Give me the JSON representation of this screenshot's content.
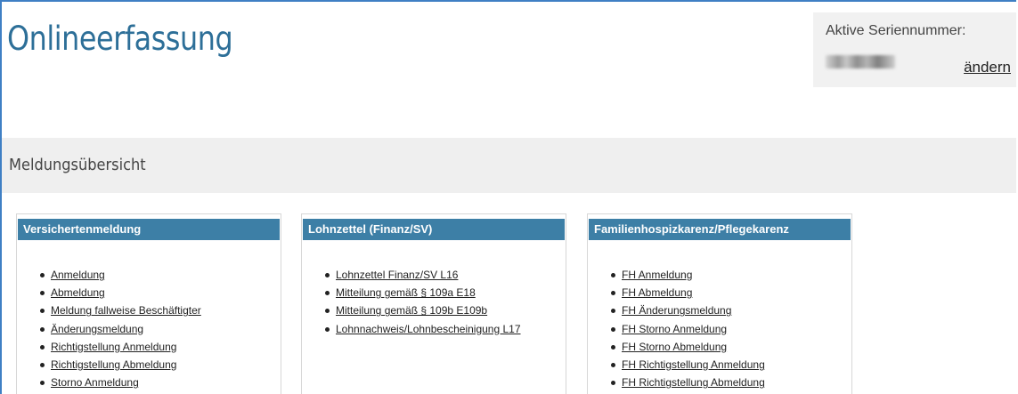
{
  "header": {
    "title": "Onlineerfassung"
  },
  "serial": {
    "label": "Aktive Seriennummer:",
    "value_redacted": true,
    "change_label": "ändern"
  },
  "overview": {
    "title": "Meldungsübersicht"
  },
  "cards": [
    {
      "title": "Versichertenmeldung",
      "items": [
        "Anmeldung",
        "Abmeldung",
        "Meldung fallweise Beschäftigter",
        "Änderungsmeldung",
        "Richtigstellung Anmeldung",
        "Richtigstellung Abmeldung",
        "Storno Anmeldung"
      ]
    },
    {
      "title": "Lohnzettel (Finanz/SV)",
      "items": [
        "Lohnzettel Finanz/SV L16",
        "Mitteilung gemäß § 109a E18",
        "Mitteilung gemäß § 109b E109b",
        "Lohnnachweis/Lohnbescheinigung L17"
      ]
    },
    {
      "title": "Familienhospizkarenz/Pflegekarenz",
      "items": [
        "FH Anmeldung",
        "FH Abmeldung",
        "FH Änderungsmeldung",
        "FH Storno Anmeldung",
        "FH Storno Abmeldung",
        "FH Richtigstellung Anmeldung",
        "FH Richtigstellung Abmeldung"
      ]
    }
  ]
}
